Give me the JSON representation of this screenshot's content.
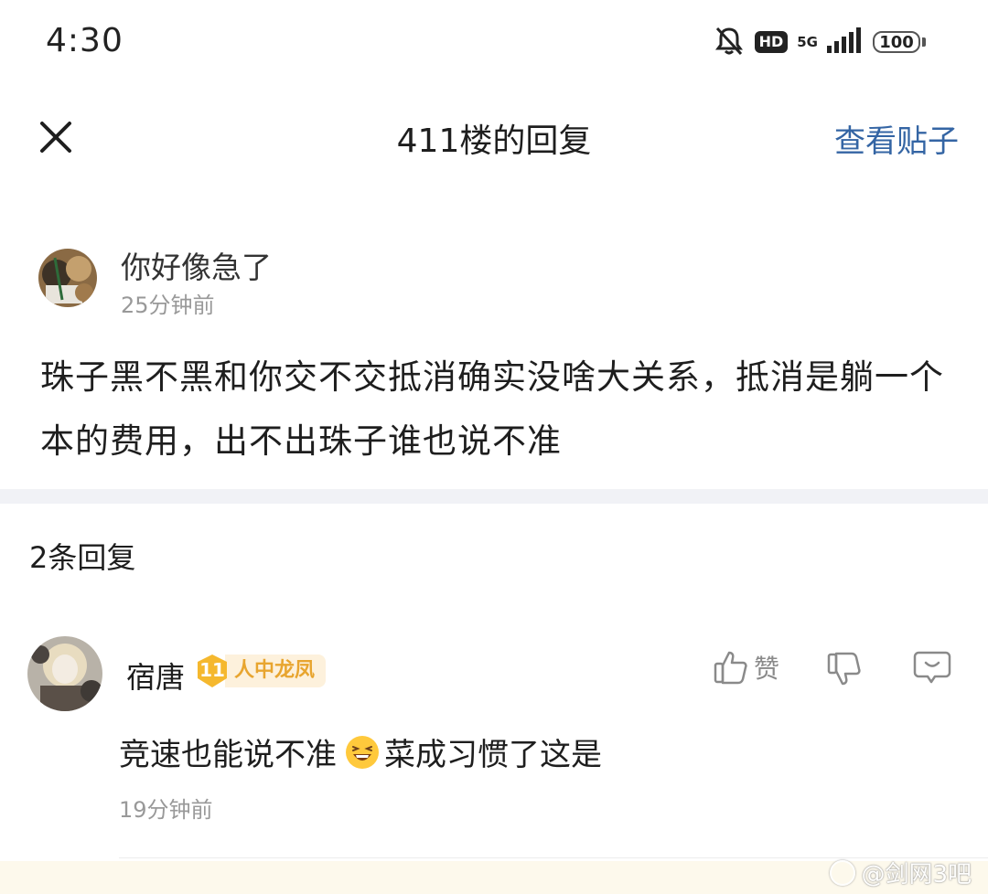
{
  "status_bar": {
    "time": "4:30",
    "icons": [
      "bell-off-icon",
      "hd-icon",
      "5g-icon",
      "signal-icon",
      "battery-icon"
    ],
    "hd": "HD",
    "network": "5G",
    "battery": "100"
  },
  "header": {
    "title": "411楼的回复",
    "view_post": "查看贴子"
  },
  "post": {
    "author": "你好像急了",
    "time": "25分钟前",
    "content": "珠子黑不黑和你交不交抵消确实没啥大关系，抵消是躺一个本的费用，出不出珠子谁也说不准"
  },
  "replies_count": "2条回复",
  "replies": [
    {
      "author": "宿唐",
      "level": "11",
      "level_title": "人中龙凤",
      "like_label": "赞",
      "content_before": "竞速也能说不准",
      "content_after": "菜成习惯了这是",
      "time": "19分钟前"
    }
  ],
  "watermark": "@剑网3吧",
  "colors": {
    "link": "#3465a4",
    "level_badge": "#f5b82e",
    "level_title_text": "#e8a52f",
    "level_title_bg": "#fdf1dc",
    "secondary_text": "#999999",
    "divider": "#f1f2f6"
  }
}
